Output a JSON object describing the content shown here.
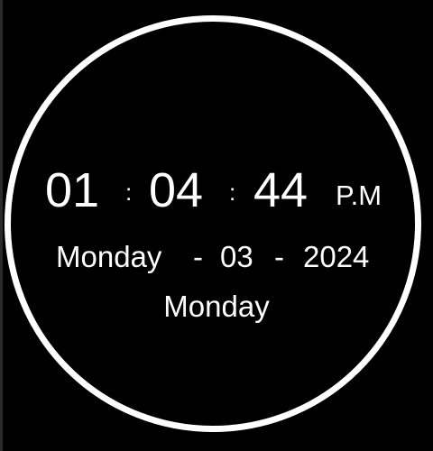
{
  "clock": {
    "hours": "01",
    "separator": ":",
    "minutes": "04",
    "seconds": "44",
    "period": "P.M"
  },
  "date": {
    "day_name": "Monday",
    "separator": "-",
    "day_number": "03",
    "year": "2024"
  },
  "weekday": "Monday",
  "colors": {
    "background": "#000000",
    "foreground": "#ffffff",
    "ring": "#ffffff"
  }
}
